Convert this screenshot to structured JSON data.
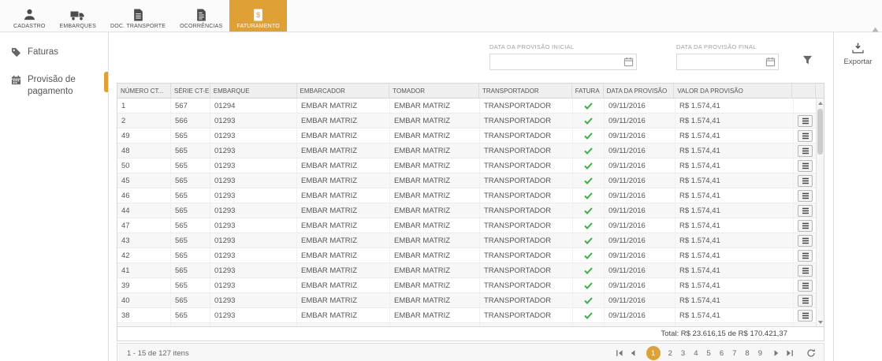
{
  "topnav": {
    "tabs": [
      {
        "label": "CADASTRO",
        "icon": "person-icon"
      },
      {
        "label": "EMBARQUES",
        "icon": "truck-icon"
      },
      {
        "label": "DOC. TRANSPORTE",
        "icon": "document-icon"
      },
      {
        "label": "OCORRÊNCIAS",
        "icon": "document-lines-icon"
      },
      {
        "label": "FATURAMENTO",
        "icon": "invoice-money-icon",
        "active": true
      }
    ]
  },
  "sidebar": {
    "items": [
      {
        "label": "Faturas",
        "icon": "tag-icon",
        "active": false
      },
      {
        "label": "Provisão de pagamento",
        "icon": "calendar-icon",
        "active": true
      }
    ]
  },
  "filters": {
    "start": {
      "label": "DATA DA PROVISÃO INICIAL",
      "value": "",
      "icon": "calendar-icon"
    },
    "end": {
      "label": "DATA DA PROVISÃO FINAL",
      "value": "",
      "icon": "calendar-icon"
    },
    "funnel_icon": "filter-funnel-icon"
  },
  "export": {
    "label": "Exportar",
    "icon": "download-icon"
  },
  "table": {
    "columns": [
      "NÚMERO CT...",
      "SÉRIE CT-E",
      "EMBARQUE",
      "EMBARCADOR",
      "TOMADOR",
      "TRANSPORTADOR",
      "FATURA",
      "DATA DA PROVISÃO",
      "VALOR DA PROVISÃO"
    ],
    "rows": [
      {
        "numero": "1",
        "serie": "567",
        "embarque": "01294",
        "embarcador": "EMBAR MATRIZ",
        "tomador": "EMBAR MATRIZ",
        "transportador": "TRANSPORTADOR",
        "fatura": true,
        "data": "09/11/2016",
        "valor": "R$ 1.574,41",
        "menu": false
      },
      {
        "numero": "2",
        "serie": "566",
        "embarque": "01293",
        "embarcador": "EMBAR MATRIZ",
        "tomador": "EMBAR MATRIZ",
        "transportador": "TRANSPORTADOR",
        "fatura": true,
        "data": "09/11/2016",
        "valor": "R$ 1.574,41",
        "menu": true
      },
      {
        "numero": "49",
        "serie": "565",
        "embarque": "01293",
        "embarcador": "EMBAR MATRIZ",
        "tomador": "EMBAR MATRIZ",
        "transportador": "TRANSPORTADOR",
        "fatura": true,
        "data": "09/11/2016",
        "valor": "R$ 1.574,41",
        "menu": true
      },
      {
        "numero": "48",
        "serie": "565",
        "embarque": "01293",
        "embarcador": "EMBAR MATRIZ",
        "tomador": "EMBAR MATRIZ",
        "transportador": "TRANSPORTADOR",
        "fatura": true,
        "data": "09/11/2016",
        "valor": "R$ 1.574,41",
        "menu": true
      },
      {
        "numero": "50",
        "serie": "565",
        "embarque": "01293",
        "embarcador": "EMBAR MATRIZ",
        "tomador": "EMBAR MATRIZ",
        "transportador": "TRANSPORTADOR",
        "fatura": true,
        "data": "09/11/2016",
        "valor": "R$ 1.574,41",
        "menu": true
      },
      {
        "numero": "45",
        "serie": "565",
        "embarque": "01293",
        "embarcador": "EMBAR MATRIZ",
        "tomador": "EMBAR MATRIZ",
        "transportador": "TRANSPORTADOR",
        "fatura": true,
        "data": "09/11/2016",
        "valor": "R$ 1.574,41",
        "menu": true
      },
      {
        "numero": "46",
        "serie": "565",
        "embarque": "01293",
        "embarcador": "EMBAR MATRIZ",
        "tomador": "EMBAR MATRIZ",
        "transportador": "TRANSPORTADOR",
        "fatura": true,
        "data": "09/11/2016",
        "valor": "R$ 1.574,41",
        "menu": true
      },
      {
        "numero": "44",
        "serie": "565",
        "embarque": "01293",
        "embarcador": "EMBAR MATRIZ",
        "tomador": "EMBAR MATRIZ",
        "transportador": "TRANSPORTADOR",
        "fatura": true,
        "data": "09/11/2016",
        "valor": "R$ 1.574,41",
        "menu": true
      },
      {
        "numero": "47",
        "serie": "565",
        "embarque": "01293",
        "embarcador": "EMBAR MATRIZ",
        "tomador": "EMBAR MATRIZ",
        "transportador": "TRANSPORTADOR",
        "fatura": true,
        "data": "09/11/2016",
        "valor": "R$ 1.574,41",
        "menu": true
      },
      {
        "numero": "43",
        "serie": "565",
        "embarque": "01293",
        "embarcador": "EMBAR MATRIZ",
        "tomador": "EMBAR MATRIZ",
        "transportador": "TRANSPORTADOR",
        "fatura": true,
        "data": "09/11/2016",
        "valor": "R$ 1.574,41",
        "menu": true
      },
      {
        "numero": "42",
        "serie": "565",
        "embarque": "01293",
        "embarcador": "EMBAR MATRIZ",
        "tomador": "EMBAR MATRIZ",
        "transportador": "TRANSPORTADOR",
        "fatura": true,
        "data": "09/11/2016",
        "valor": "R$ 1.574,41",
        "menu": true
      },
      {
        "numero": "41",
        "serie": "565",
        "embarque": "01293",
        "embarcador": "EMBAR MATRIZ",
        "tomador": "EMBAR MATRIZ",
        "transportador": "TRANSPORTADOR",
        "fatura": true,
        "data": "09/11/2016",
        "valor": "R$ 1.574,41",
        "menu": true
      },
      {
        "numero": "39",
        "serie": "565",
        "embarque": "01293",
        "embarcador": "EMBAR MATRIZ",
        "tomador": "EMBAR MATRIZ",
        "transportador": "TRANSPORTADOR",
        "fatura": true,
        "data": "09/11/2016",
        "valor": "R$ 1.574,41",
        "menu": true
      },
      {
        "numero": "40",
        "serie": "565",
        "embarque": "01293",
        "embarcador": "EMBAR MATRIZ",
        "tomador": "EMBAR MATRIZ",
        "transportador": "TRANSPORTADOR",
        "fatura": true,
        "data": "09/11/2016",
        "valor": "R$ 1.574,41",
        "menu": true
      },
      {
        "numero": "38",
        "serie": "565",
        "embarque": "01293",
        "embarcador": "EMBAR MATRIZ",
        "tomador": "EMBAR MATRIZ",
        "transportador": "TRANSPORTADOR",
        "fatura": true,
        "data": "09/11/2016",
        "valor": "R$ 1.574,41",
        "menu": true
      },
      {
        "numero": "",
        "serie": "",
        "embarque": "",
        "embarcador": "",
        "tomador": "",
        "transportador": "",
        "fatura": false,
        "data": "",
        "valor": "",
        "menu": false
      }
    ],
    "total": "Total: R$ 23.616,15 de R$ 170.421,37"
  },
  "pagination": {
    "summary": "1 - 15 de 127 itens",
    "pages": [
      "1",
      "2",
      "3",
      "4",
      "5",
      "6",
      "7",
      "8",
      "9"
    ],
    "current": "1",
    "icons": [
      "first-page-icon",
      "prev-page-icon",
      "next-page-icon",
      "last-page-icon",
      "refresh-icon"
    ]
  },
  "colors": {
    "accent": "#dfa136",
    "check_green": "#3fae49"
  }
}
